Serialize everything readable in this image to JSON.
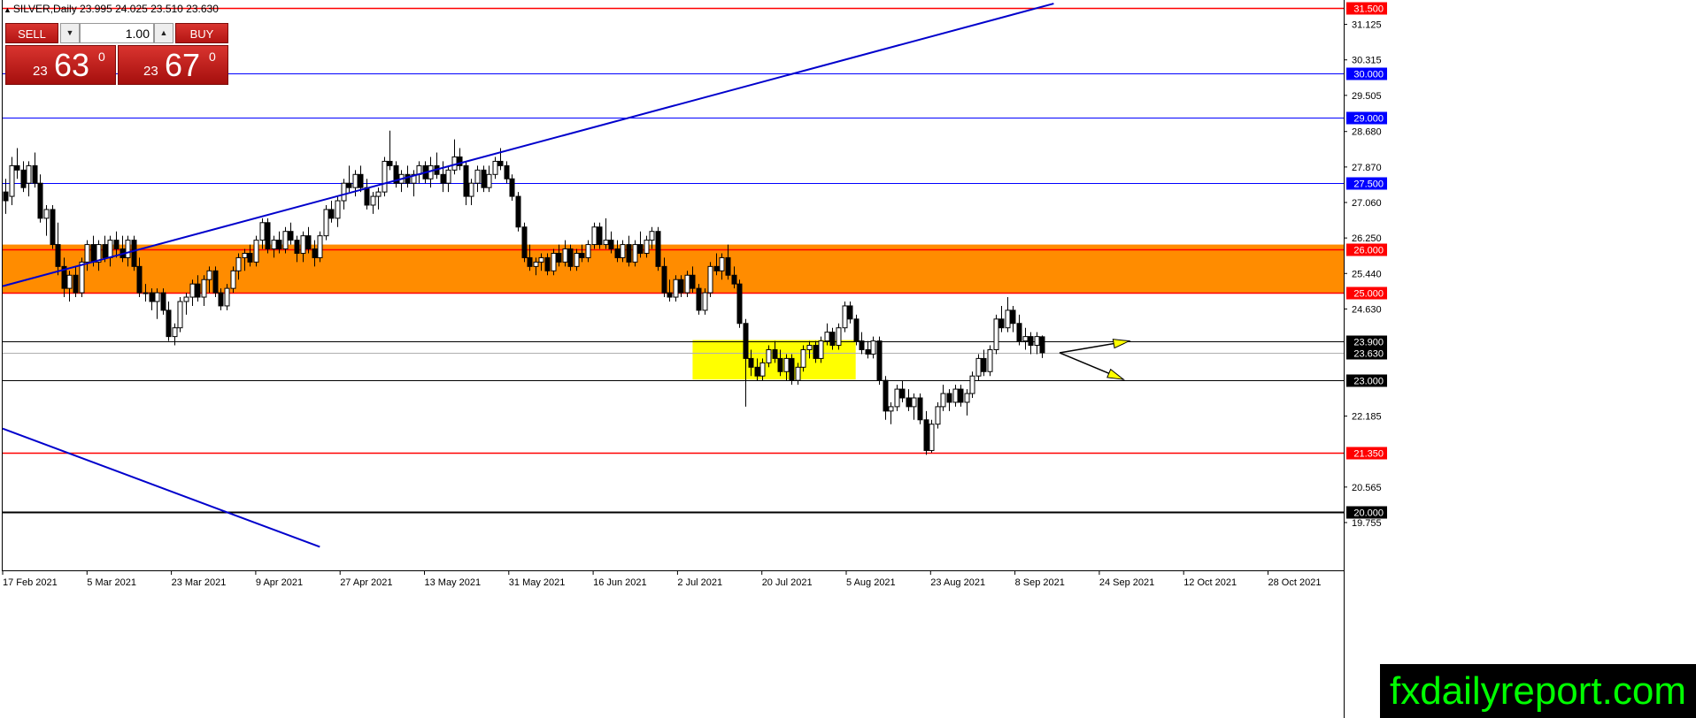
{
  "window": {
    "title": "SILVER,Daily  23.995 24.025 23.510 23.630"
  },
  "trade_panel": {
    "sell_label": "SELL",
    "buy_label": "BUY",
    "lot_value": "1.00",
    "bid": {
      "prefix": "23",
      "big": "63",
      "sup": "0"
    },
    "ask": {
      "prefix": "23",
      "big": "67",
      "sup": "0"
    }
  },
  "watermark": "fxdailyreport.com",
  "colors": {
    "orange_zone": "#ff8c00",
    "yellow_zone": "#ffff00",
    "red_line": "#ff0000",
    "blue_line": "#0000ff",
    "trend_line": "#0000cc"
  },
  "chart_data": {
    "type": "candlestick",
    "symbol": "SILVER",
    "timeframe": "Daily",
    "ylim": [
      19.2,
      31.6
    ],
    "price_axis_ticks": [
      "31.125",
      "30.315",
      "29.505",
      "28.680",
      "27.870",
      "27.060",
      "26.250",
      "25.440",
      "24.630",
      "22.185",
      "20.565",
      "19.755"
    ],
    "time_axis_labels": [
      "17 Feb 2021",
      "5 Mar 2021",
      "23 Mar 2021",
      "9 Apr 2021",
      "27 Apr 2021",
      "13 May 2021",
      "31 May 2021",
      "16 Jun 2021",
      "2 Jul 2021",
      "20 Jul 2021",
      "5 Aug 2021",
      "23 Aug 2021",
      "8 Sep 2021",
      "24 Sep 2021",
      "12 Oct 2021",
      "28 Oct 2021"
    ],
    "horizontal_levels": [
      {
        "label": "31.500",
        "value": 31.5,
        "style": "red"
      },
      {
        "label": "30.000",
        "value": 30.0,
        "style": "blue"
      },
      {
        "label": "29.000",
        "value": 29.0,
        "style": "blue"
      },
      {
        "label": "27.500",
        "value": 27.5,
        "style": "blue"
      },
      {
        "label": "26.000",
        "value": 26.0,
        "style": "red"
      },
      {
        "label": "25.000",
        "value": 25.0,
        "style": "red"
      },
      {
        "label": "23.900",
        "value": 23.9,
        "style": "black"
      },
      {
        "label": "23.630",
        "value": 23.63,
        "style": "current"
      },
      {
        "label": "23.000",
        "value": 23.0,
        "style": "black"
      },
      {
        "label": "21.350",
        "value": 21.35,
        "style": "red"
      },
      {
        "label": "20.000",
        "value": 20.0,
        "style": "black-thick"
      }
    ],
    "zones": [
      {
        "name": "resistance-zone",
        "from_index": 0,
        "to_index": 188,
        "low": 25.0,
        "high": 26.1,
        "color": "orange"
      },
      {
        "name": "consolidation-zone",
        "from_index": 118,
        "to_index": 146,
        "low": 23.02,
        "high": 23.92,
        "color": "yellow"
      }
    ],
    "trend_lines": [
      {
        "name": "ascending-trendline",
        "from": {
          "index": 0,
          "price": 25.15
        },
        "to": {
          "index": 180,
          "price": 31.6
        }
      },
      {
        "name": "descending-trendline",
        "from": {
          "index": 0,
          "price": 21.9
        },
        "to": {
          "index": 54,
          "price": 19.2
        }
      }
    ],
    "arrows": [
      {
        "name": "arrow-up",
        "from": {
          "index": 181,
          "price": 23.63
        },
        "to": {
          "index": 193,
          "price": 23.9
        }
      },
      {
        "name": "arrow-down",
        "from": {
          "index": 181,
          "price": 23.63
        },
        "to": {
          "index": 192,
          "price": 23.02
        }
      }
    ],
    "candles": [
      [
        27.3,
        27.6,
        26.8,
        27.1
      ],
      [
        27.2,
        28.1,
        27.0,
        27.9
      ],
      [
        27.9,
        28.3,
        27.6,
        27.8
      ],
      [
        27.8,
        28.0,
        27.3,
        27.4
      ],
      [
        27.5,
        28.0,
        27.2,
        27.9
      ],
      [
        27.9,
        28.2,
        27.4,
        27.5
      ],
      [
        27.5,
        27.7,
        26.6,
        26.7
      ],
      [
        26.7,
        27.0,
        26.3,
        26.9
      ],
      [
        26.9,
        27.0,
        26.0,
        26.1
      ],
      [
        26.1,
        26.6,
        25.4,
        25.6
      ],
      [
        25.6,
        25.8,
        24.9,
        25.1
      ],
      [
        25.1,
        25.5,
        24.8,
        25.4
      ],
      [
        25.4,
        25.6,
        24.9,
        25.0
      ],
      [
        25.0,
        25.8,
        24.9,
        25.7
      ],
      [
        25.7,
        26.2,
        25.5,
        26.1
      ],
      [
        26.1,
        26.3,
        25.6,
        25.7
      ],
      [
        25.7,
        26.2,
        25.5,
        26.1
      ],
      [
        26.1,
        26.3,
        25.7,
        25.8
      ],
      [
        25.8,
        26.3,
        25.6,
        26.2
      ],
      [
        26.2,
        26.4,
        25.8,
        26.0
      ],
      [
        26.0,
        26.3,
        25.7,
        25.8
      ],
      [
        25.8,
        26.3,
        25.6,
        26.2
      ],
      [
        26.2,
        26.3,
        25.5,
        25.6
      ],
      [
        25.6,
        25.8,
        24.9,
        25.0
      ],
      [
        25.0,
        25.2,
        24.8,
        25.0
      ],
      [
        25.0,
        25.1,
        24.6,
        24.8
      ],
      [
        24.8,
        25.1,
        24.4,
        25.0
      ],
      [
        25.0,
        25.1,
        24.5,
        24.6
      ],
      [
        24.6,
        24.8,
        23.9,
        24.0
      ],
      [
        24.0,
        24.3,
        23.8,
        24.2
      ],
      [
        24.2,
        24.9,
        24.1,
        24.8
      ],
      [
        24.8,
        25.0,
        24.5,
        24.9
      ],
      [
        24.9,
        25.3,
        24.7,
        25.2
      ],
      [
        25.2,
        25.4,
        24.8,
        24.9
      ],
      [
        24.9,
        25.4,
        24.7,
        25.3
      ],
      [
        25.3,
        25.6,
        25.0,
        25.5
      ],
      [
        25.5,
        25.6,
        24.9,
        25.0
      ],
      [
        25.0,
        25.1,
        24.6,
        24.7
      ],
      [
        24.7,
        25.2,
        24.6,
        25.1
      ],
      [
        25.1,
        25.6,
        25.0,
        25.5
      ],
      [
        25.5,
        25.9,
        25.3,
        25.8
      ],
      [
        25.8,
        26.0,
        25.5,
        25.9
      ],
      [
        25.9,
        26.1,
        25.6,
        25.7
      ],
      [
        25.7,
        26.3,
        25.6,
        26.2
      ],
      [
        26.2,
        26.7,
        26.0,
        26.6
      ],
      [
        26.6,
        26.7,
        25.9,
        26.0
      ],
      [
        26.0,
        26.3,
        25.8,
        26.2
      ],
      [
        26.2,
        26.4,
        25.9,
        26.0
      ],
      [
        26.0,
        26.5,
        25.9,
        26.4
      ],
      [
        26.4,
        26.6,
        26.1,
        26.2
      ],
      [
        26.2,
        26.3,
        25.7,
        25.9
      ],
      [
        25.9,
        26.4,
        25.7,
        26.3
      ],
      [
        26.3,
        26.5,
        25.9,
        26.0
      ],
      [
        26.0,
        26.2,
        25.6,
        25.8
      ],
      [
        25.8,
        26.4,
        25.7,
        26.3
      ],
      [
        26.3,
        27.0,
        26.2,
        26.9
      ],
      [
        26.9,
        27.1,
        26.6,
        26.7
      ],
      [
        26.7,
        27.2,
        26.5,
        27.1
      ],
      [
        27.1,
        27.6,
        26.9,
        27.5
      ],
      [
        27.5,
        27.9,
        27.3,
        27.4
      ],
      [
        27.4,
        27.8,
        27.2,
        27.7
      ],
      [
        27.7,
        27.9,
        27.3,
        27.4
      ],
      [
        27.4,
        27.6,
        26.9,
        27.0
      ],
      [
        27.0,
        27.3,
        26.8,
        27.2
      ],
      [
        27.2,
        27.4,
        26.9,
        27.3
      ],
      [
        27.3,
        28.1,
        27.2,
        28.0
      ],
      [
        28.0,
        28.7,
        27.8,
        27.9
      ],
      [
        27.9,
        28.0,
        27.4,
        27.5
      ],
      [
        27.5,
        27.8,
        27.3,
        27.7
      ],
      [
        27.7,
        27.9,
        27.4,
        27.5
      ],
      [
        27.5,
        27.8,
        27.2,
        27.7
      ],
      [
        27.7,
        28.0,
        27.5,
        27.9
      ],
      [
        27.9,
        28.0,
        27.5,
        27.6
      ],
      [
        27.6,
        28.1,
        27.4,
        27.9
      ],
      [
        27.9,
        28.2,
        27.6,
        27.7
      ],
      [
        27.7,
        28.0,
        27.3,
        27.5
      ],
      [
        27.5,
        27.9,
        27.3,
        27.8
      ],
      [
        27.8,
        28.5,
        27.7,
        28.1
      ],
      [
        28.1,
        28.3,
        27.8,
        27.9
      ],
      [
        27.9,
        28.0,
        27.0,
        27.2
      ],
      [
        27.2,
        27.6,
        27.0,
        27.5
      ],
      [
        27.5,
        27.9,
        27.3,
        27.8
      ],
      [
        27.8,
        27.9,
        27.3,
        27.4
      ],
      [
        27.4,
        27.9,
        27.3,
        27.7
      ],
      [
        27.7,
        28.1,
        27.6,
        28.0
      ],
      [
        28.0,
        28.3,
        27.8,
        27.9
      ],
      [
        27.9,
        28.0,
        27.5,
        27.6
      ],
      [
        27.6,
        27.7,
        27.1,
        27.2
      ],
      [
        27.2,
        27.3,
        26.4,
        26.5
      ],
      [
        26.5,
        26.6,
        25.7,
        25.8
      ],
      [
        25.8,
        26.1,
        25.5,
        25.6
      ],
      [
        25.6,
        25.8,
        25.4,
        25.7
      ],
      [
        25.7,
        25.9,
        25.5,
        25.8
      ],
      [
        25.8,
        25.9,
        25.4,
        25.5
      ],
      [
        25.5,
        26.0,
        25.4,
        25.9
      ],
      [
        25.9,
        26.1,
        25.6,
        25.7
      ],
      [
        25.7,
        26.2,
        25.6,
        26.0
      ],
      [
        26.0,
        26.1,
        25.5,
        25.6
      ],
      [
        25.6,
        26.0,
        25.5,
        25.9
      ],
      [
        25.9,
        26.1,
        25.7,
        25.8
      ],
      [
        25.8,
        26.2,
        25.7,
        26.1
      ],
      [
        26.1,
        26.6,
        26.0,
        26.5
      ],
      [
        26.5,
        26.6,
        26.0,
        26.1
      ],
      [
        26.1,
        26.7,
        26.0,
        26.2
      ],
      [
        26.2,
        26.4,
        25.9,
        26.0
      ],
      [
        26.0,
        26.2,
        25.7,
        25.8
      ],
      [
        25.8,
        26.2,
        25.7,
        26.1
      ],
      [
        26.1,
        26.3,
        25.6,
        25.7
      ],
      [
        25.7,
        26.2,
        25.6,
        26.1
      ],
      [
        26.1,
        26.4,
        25.8,
        25.9
      ],
      [
        25.9,
        26.3,
        25.8,
        26.2
      ],
      [
        26.2,
        26.5,
        26.0,
        26.4
      ],
      [
        26.4,
        26.5,
        25.5,
        25.6
      ],
      [
        25.6,
        25.8,
        24.9,
        25.0
      ],
      [
        25.0,
        25.3,
        24.8,
        24.9
      ],
      [
        24.9,
        25.4,
        24.8,
        25.3
      ],
      [
        25.3,
        25.4,
        24.9,
        25.0
      ],
      [
        25.0,
        25.5,
        24.9,
        25.4
      ],
      [
        25.4,
        25.6,
        25.0,
        25.1
      ],
      [
        25.1,
        25.2,
        24.5,
        24.6
      ],
      [
        24.6,
        25.1,
        24.5,
        25.0
      ],
      [
        25.0,
        25.7,
        24.9,
        25.6
      ],
      [
        25.6,
        25.9,
        25.4,
        25.5
      ],
      [
        25.5,
        25.9,
        25.3,
        25.8
      ],
      [
        25.8,
        26.1,
        25.3,
        25.4
      ],
      [
        25.4,
        25.6,
        25.1,
        25.2
      ],
      [
        25.2,
        25.3,
        24.2,
        24.3
      ],
      [
        24.3,
        24.4,
        22.4,
        23.5
      ],
      [
        23.5,
        23.7,
        23.1,
        23.3
      ],
      [
        23.3,
        23.5,
        23.0,
        23.1
      ],
      [
        23.1,
        23.5,
        23.0,
        23.4
      ],
      [
        23.4,
        23.8,
        23.3,
        23.7
      ],
      [
        23.7,
        23.9,
        23.4,
        23.5
      ],
      [
        23.5,
        23.7,
        23.1,
        23.2
      ],
      [
        23.2,
        23.6,
        23.0,
        23.5
      ],
      [
        23.5,
        23.6,
        22.9,
        23.0
      ],
      [
        23.0,
        23.4,
        22.9,
        23.3
      ],
      [
        23.3,
        23.8,
        23.2,
        23.7
      ],
      [
        23.7,
        23.9,
        23.5,
        23.8
      ],
      [
        23.8,
        23.9,
        23.4,
        23.5
      ],
      [
        23.5,
        24.0,
        23.4,
        23.9
      ],
      [
        23.9,
        24.3,
        23.8,
        24.1
      ],
      [
        24.1,
        24.2,
        23.7,
        23.8
      ],
      [
        23.8,
        24.3,
        23.7,
        24.2
      ],
      [
        24.2,
        24.8,
        24.1,
        24.7
      ],
      [
        24.7,
        24.8,
        24.3,
        24.4
      ],
      [
        24.4,
        24.5,
        23.8,
        23.9
      ],
      [
        23.9,
        24.1,
        23.6,
        23.7
      ],
      [
        23.7,
        23.9,
        23.5,
        23.6
      ],
      [
        23.6,
        24.0,
        23.5,
        23.9
      ],
      [
        23.9,
        24.0,
        22.9,
        23.0
      ],
      [
        23.0,
        23.1,
        22.1,
        22.3
      ],
      [
        22.3,
        22.5,
        22.0,
        22.4
      ],
      [
        22.4,
        22.9,
        22.3,
        22.8
      ],
      [
        22.8,
        23.0,
        22.5,
        22.6
      ],
      [
        22.6,
        22.8,
        22.3,
        22.4
      ],
      [
        22.4,
        22.7,
        22.1,
        22.6
      ],
      [
        22.6,
        22.7,
        22.0,
        22.1
      ],
      [
        22.1,
        22.3,
        21.3,
        21.4
      ],
      [
        21.4,
        22.1,
        21.35,
        22.0
      ],
      [
        22.0,
        22.5,
        21.9,
        22.4
      ],
      [
        22.4,
        22.9,
        22.3,
        22.7
      ],
      [
        22.7,
        22.8,
        22.3,
        22.5
      ],
      [
        22.5,
        22.9,
        22.4,
        22.8
      ],
      [
        22.8,
        22.9,
        22.4,
        22.5
      ],
      [
        22.5,
        22.8,
        22.2,
        22.7
      ],
      [
        22.7,
        23.2,
        22.6,
        23.1
      ],
      [
        23.1,
        23.6,
        23.0,
        23.5
      ],
      [
        23.5,
        23.7,
        23.1,
        23.2
      ],
      [
        23.2,
        23.8,
        23.1,
        23.7
      ],
      [
        23.7,
        24.5,
        23.6,
        24.4
      ],
      [
        24.4,
        24.7,
        24.1,
        24.2
      ],
      [
        24.2,
        24.9,
        24.1,
        24.6
      ],
      [
        24.6,
        24.7,
        24.1,
        24.3
      ],
      [
        24.3,
        24.5,
        23.8,
        23.9
      ],
      [
        23.9,
        24.2,
        23.7,
        24.0
      ],
      [
        24.0,
        24.1,
        23.6,
        23.8
      ],
      [
        23.8,
        24.1,
        23.6,
        24.0
      ],
      [
        23.995,
        24.025,
        23.51,
        23.63
      ]
    ]
  }
}
